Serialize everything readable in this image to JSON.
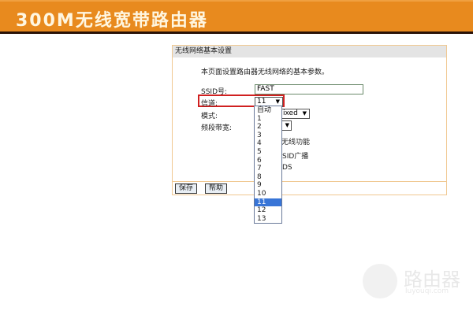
{
  "header": {
    "title": "300M无线宽带路由器"
  },
  "panel": {
    "title": "无线网络基本设置",
    "description": "本页面设置路由器无线网络的基本参数。",
    "ssid_label": "SSID号:",
    "ssid_value": "FAST",
    "channel_label": "信道:",
    "channel_value": "11",
    "mode_label": "模式:",
    "mode_value_partial": "ixed",
    "bandwidth_label": "频段带宽:",
    "opt_wireless_partial": "无线功能",
    "opt_ssid_partial": "SID广播",
    "opt_wds_partial": "DS",
    "save_label": "保存",
    "help_label": "帮助"
  },
  "dropdown": {
    "options": [
      "自动",
      "1",
      "2",
      "3",
      "4",
      "5",
      "6",
      "7",
      "8",
      "9",
      "10",
      "11",
      "12",
      "13"
    ],
    "selected": "11"
  },
  "watermark": {
    "text": "路由器",
    "url": "luyouqi.com"
  }
}
